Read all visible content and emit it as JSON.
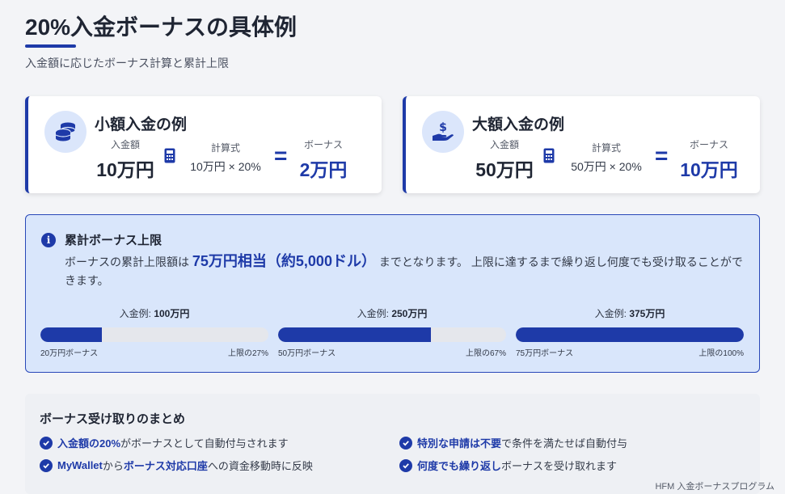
{
  "header": {
    "title": "20%入金ボーナスの具体例",
    "subtitle": "入金額に応じたボーナス計算と累計上限"
  },
  "examples": [
    {
      "title": "小額入金の例",
      "icon": "coins-icon",
      "deposit_label": "入金額",
      "deposit": "10万円",
      "formula_label": "計算式",
      "formula": "10万円 × 20%",
      "bonus_label": "ボーナス",
      "bonus": "2万円"
    },
    {
      "title": "大額入金の例",
      "icon": "hand-dollar-icon",
      "deposit_label": "入金額",
      "deposit": "50万円",
      "formula_label": "計算式",
      "formula": "50万円 × 20%",
      "bonus_label": "ボーナス",
      "bonus": "10万円"
    }
  ],
  "limit": {
    "title": "累計ボーナス上限",
    "text_before": "ボーナスの累計上限額は ",
    "highlight": "75万円相当（約5,000ドル）",
    "text_after": " までとなります。 上限に達するまで繰り返し何度でも受け取ることができます。",
    "bars": [
      {
        "head_label": "入金例: ",
        "head_value": "100万円",
        "bonus": "20万円ボーナス",
        "percent_label": "上限の27%",
        "fill": 27
      },
      {
        "head_label": "入金例: ",
        "head_value": "250万円",
        "bonus": "50万円ボーナス",
        "percent_label": "上限の67%",
        "fill": 67
      },
      {
        "head_label": "入金例: ",
        "head_value": "375万円",
        "bonus": "75万円ボーナス",
        "percent_label": "上限の100%",
        "fill": 100
      }
    ]
  },
  "summary": {
    "title": "ボーナス受け取りのまとめ",
    "items": [
      {
        "bold": "入金額の20%",
        "rest": "がボーナスとして自動付与されます"
      },
      {
        "bold": "特別な申請は不要",
        "rest": "で条件を満たせば自動付与"
      },
      {
        "pre": "MyWallet",
        "mid": "から",
        "bold": "ボーナス対応口座",
        "rest": "への資金移動時に反映"
      },
      {
        "bold": "何度でも繰り返し",
        "rest": "ボーナスを受け取れます"
      }
    ]
  },
  "footer": "HFM 入金ボーナスプログラム",
  "colors": {
    "accent": "#1e3aa8",
    "light_blue": "#d9e6fb",
    "track": "#e5e7ec"
  }
}
